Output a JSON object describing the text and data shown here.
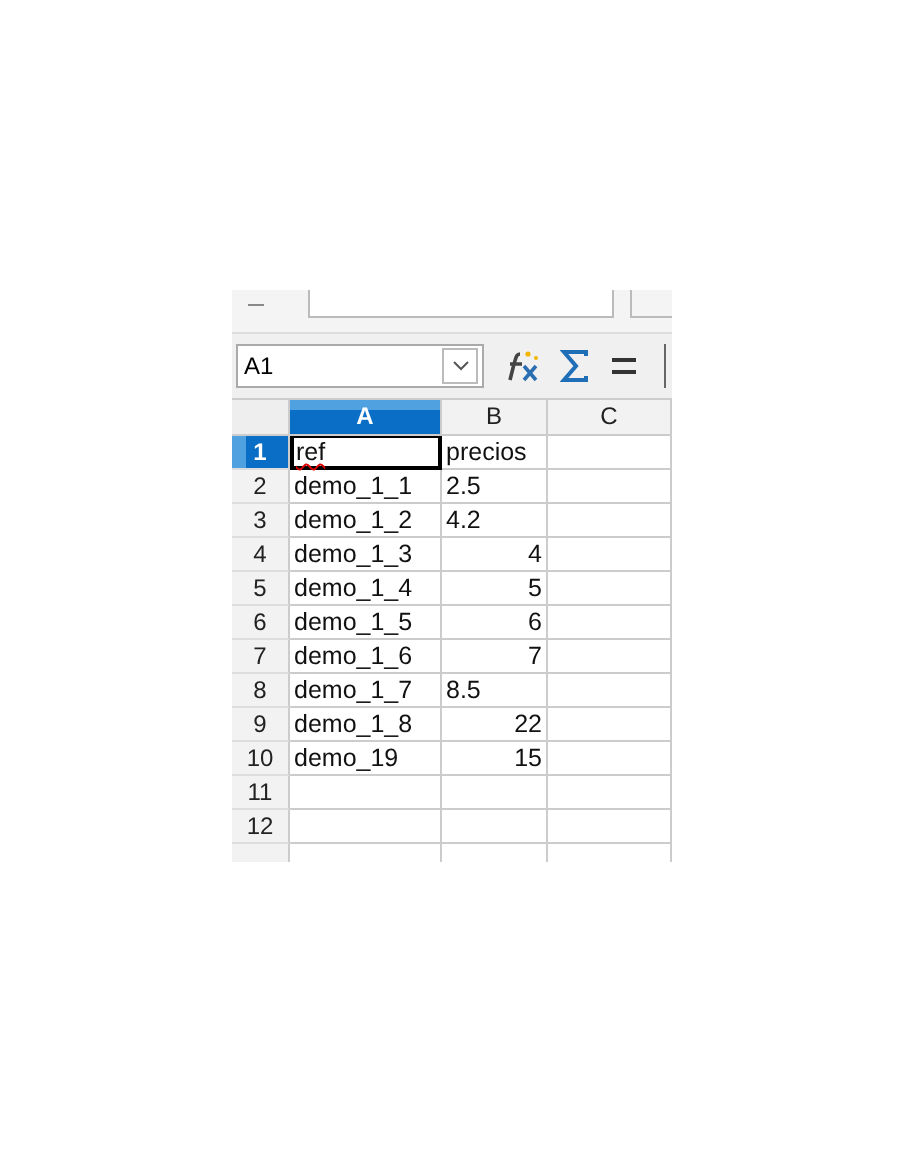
{
  "name_box": {
    "value": "A1"
  },
  "columns": [
    {
      "label": "A",
      "selected": true
    },
    {
      "label": "B",
      "selected": false
    },
    {
      "label": "C",
      "selected": false
    }
  ],
  "rows": [
    {
      "label": "1",
      "selected": true,
      "cells": [
        {
          "text": "ref",
          "kind": "text",
          "selected": true
        },
        {
          "text": "precios",
          "kind": "text",
          "selected": false
        }
      ]
    },
    {
      "label": "2",
      "selected": false,
      "cells": [
        {
          "text": "demo_1_1",
          "kind": "text",
          "selected": false
        },
        {
          "text": "2.5",
          "kind": "text",
          "selected": false
        }
      ]
    },
    {
      "label": "3",
      "selected": false,
      "cells": [
        {
          "text": "demo_1_2",
          "kind": "text",
          "selected": false
        },
        {
          "text": "4.2",
          "kind": "text",
          "selected": false
        }
      ]
    },
    {
      "label": "4",
      "selected": false,
      "cells": [
        {
          "text": "demo_1_3",
          "kind": "text",
          "selected": false
        },
        {
          "text": "4",
          "kind": "number",
          "selected": false
        }
      ]
    },
    {
      "label": "5",
      "selected": false,
      "cells": [
        {
          "text": "demo_1_4",
          "kind": "text",
          "selected": false
        },
        {
          "text": "5",
          "kind": "number",
          "selected": false
        }
      ]
    },
    {
      "label": "6",
      "selected": false,
      "cells": [
        {
          "text": "demo_1_5",
          "kind": "text",
          "selected": false
        },
        {
          "text": "6",
          "kind": "number",
          "selected": false
        }
      ]
    },
    {
      "label": "7",
      "selected": false,
      "cells": [
        {
          "text": "demo_1_6",
          "kind": "text",
          "selected": false
        },
        {
          "text": "7",
          "kind": "number",
          "selected": false
        }
      ]
    },
    {
      "label": "8",
      "selected": false,
      "cells": [
        {
          "text": "demo_1_7",
          "kind": "text",
          "selected": false
        },
        {
          "text": "8.5",
          "kind": "text",
          "selected": false
        }
      ]
    },
    {
      "label": "9",
      "selected": false,
      "cells": [
        {
          "text": "demo_1_8",
          "kind": "text",
          "selected": false
        },
        {
          "text": "22",
          "kind": "number",
          "selected": false
        }
      ]
    },
    {
      "label": "10",
      "selected": false,
      "cells": [
        {
          "text": "demo_19",
          "kind": "text",
          "selected": false
        },
        {
          "text": "15",
          "kind": "number",
          "selected": false
        }
      ]
    },
    {
      "label": "11",
      "selected": false,
      "cells": []
    },
    {
      "label": "12",
      "selected": false,
      "cells": []
    }
  ]
}
